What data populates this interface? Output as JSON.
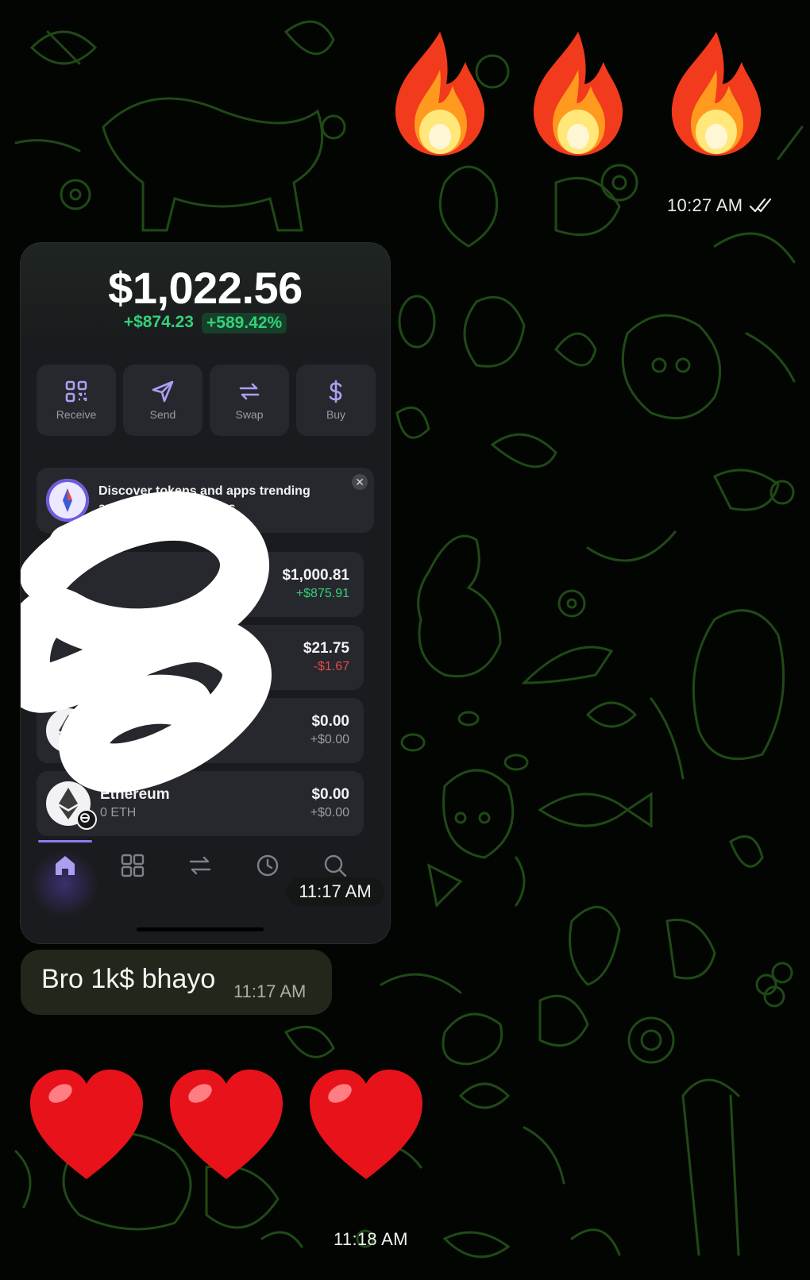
{
  "chat": {
    "reaction_top": {
      "emoji": "🔥",
      "count": 3,
      "time": "10:27 AM",
      "status_icon": "double-check-icon"
    },
    "reaction_bottom": {
      "emoji": "❤️",
      "count": 3,
      "time": "11:18 AM"
    },
    "message": {
      "text": "Bro 1k$ bhayo",
      "time": "11:17 AM"
    }
  },
  "wallet": {
    "balance": "$1,022.56",
    "change_value": "+$874.23",
    "change_percent": "+589.42%",
    "actions": [
      {
        "label": "Receive",
        "icon": "qr-code-icon"
      },
      {
        "label": "Send",
        "icon": "send-icon"
      },
      {
        "label": "Swap",
        "icon": "swap-icon"
      },
      {
        "label": "Buy",
        "icon": "dollar-icon"
      }
    ],
    "banner": {
      "text": "Discover tokens and apps trending among Phantom users"
    },
    "tokens": [
      {
        "name": "",
        "amount": "",
        "value": "$1,000.81",
        "change": "+$875.91",
        "trend": "up"
      },
      {
        "name": "",
        "amount": "",
        "value": "$21.75",
        "change": "-$1.67",
        "trend": "down"
      },
      {
        "name": "",
        "amount": "",
        "value": "$0.00",
        "change": "+$0.00",
        "trend": "flat"
      },
      {
        "name": "Ethereum",
        "amount": "0 ETH",
        "value": "$0.00",
        "change": "+$0.00",
        "trend": "flat"
      }
    ],
    "nav": [
      "home-icon",
      "grid-icon",
      "swap-icon",
      "history-icon",
      "search-icon"
    ],
    "screenshot_time": "11:17 AM"
  },
  "colors": {
    "background": "#030503",
    "doodle": "#1f4a16",
    "gain": "#33d17a",
    "loss": "#e5484d",
    "accent": "#ab9ff2",
    "bubble": "#23271b"
  }
}
